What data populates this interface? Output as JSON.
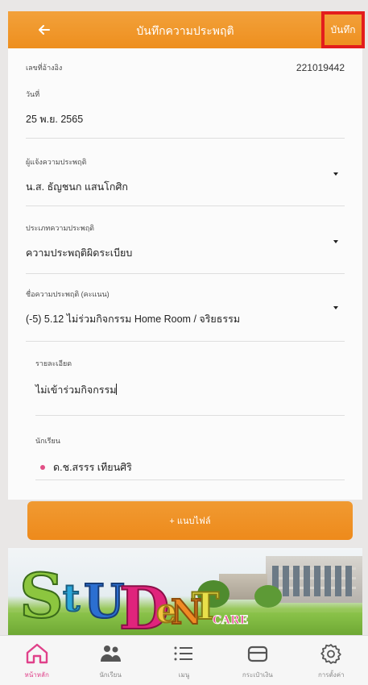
{
  "header": {
    "title": "บันทึกความประพฤติ",
    "save_label": "บันทึก",
    "back_icon": "arrow-left-icon"
  },
  "form": {
    "id_label": "เลขที่อ้างอิง",
    "id_value": "221019442",
    "date_label": "วันที่",
    "date_value": "25 พ.ย. 2565",
    "reporter_label": "ผู้แจ้งความประพฤติ",
    "reporter_value": "น.ส. ธัญชนก แสนโกศิก",
    "type_label": "ประเภทความประพฤติ",
    "type_value": "ความประพฤติผิดระเบียบ",
    "behavior_label": "ชื่อความประพฤติ (คะแนน)",
    "behavior_value": "(-5) 5.12 ไม่ร่วมกิจกรรม Home Room / จริยธรรม",
    "detail_label": "รายละเอียด",
    "detail_value": "ไม่เข้าร่วมกิจกรรม",
    "student_label": "นักเรียน",
    "student_value": "ด.ช.สรรร เทียนศิริ"
  },
  "attach_button": {
    "label": "+ แนบไฟล์"
  },
  "banner": {
    "logo_letters": [
      "S",
      "t",
      "U",
      "D",
      "e",
      "N",
      "T"
    ],
    "logo_sub": "CARE"
  },
  "bottom_nav": [
    {
      "label": "หน้าหลัก",
      "icon": "home-icon",
      "active": true
    },
    {
      "label": "นักเรียน",
      "icon": "students-icon",
      "active": false
    },
    {
      "label": "เมนู",
      "icon": "list-icon",
      "active": false
    },
    {
      "label": "กระเป๋าเงิน",
      "icon": "wallet-icon",
      "active": false
    },
    {
      "label": "การตั้งค่า",
      "icon": "gear-icon",
      "active": false
    }
  ],
  "colors": {
    "accent": "#ee8f1e",
    "active_nav": "#e0418a",
    "highlight_box": "#e31d1d"
  }
}
